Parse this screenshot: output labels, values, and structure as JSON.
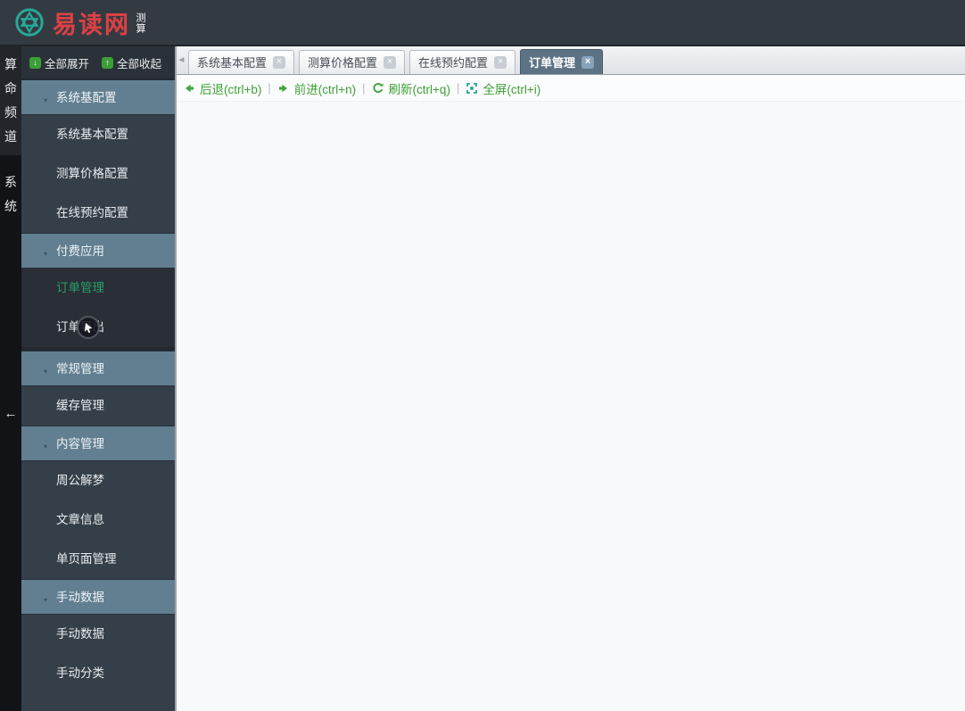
{
  "topbar": {
    "logo_text": "易读网",
    "logo_badge": "测算",
    "logo_icon": "hexagram-circle-icon",
    "colors": {
      "logo_red": "#dd4144",
      "logo_teal": "#27a898",
      "bar_bg": "#343a42"
    }
  },
  "channel_strip": {
    "channels": [
      {
        "label": "算命频道",
        "active": true
      },
      {
        "label": "系统",
        "active": false
      }
    ],
    "collapse_arrow": "←"
  },
  "sidebar": {
    "expand_all": "全部展开",
    "collapse_all": "全部收起",
    "expand_icon": "green-down-arrow-icon",
    "collapse_icon": "green-up-arrow-icon",
    "groups": [
      {
        "label": "系统基配置",
        "dark_submenu": false,
        "items": [
          {
            "label": "系统基本配置",
            "active": false
          },
          {
            "label": "测算价格配置",
            "active": false
          },
          {
            "label": "在线预约配置",
            "active": false
          }
        ]
      },
      {
        "label": "付费应用",
        "dark_submenu": true,
        "items": [
          {
            "label": "订单管理",
            "active": true
          },
          {
            "label": "订单导出",
            "active": false
          }
        ]
      },
      {
        "label": "常规管理",
        "dark_submenu": false,
        "items": [
          {
            "label": "缓存管理",
            "active": false
          }
        ]
      },
      {
        "label": "内容管理",
        "dark_submenu": false,
        "items": [
          {
            "label": "周公解梦",
            "active": false
          },
          {
            "label": "文章信息",
            "active": false
          },
          {
            "label": "单页面管理",
            "active": false
          }
        ]
      },
      {
        "label": "手动数据",
        "dark_submenu": false,
        "items": [
          {
            "label": "手动数据",
            "active": false
          },
          {
            "label": "手动分类",
            "active": false
          }
        ]
      }
    ],
    "colors": {
      "group_header": "#617f90",
      "item_bg": "#353f4a",
      "dark_submenu_bg": "#2a2e37",
      "active_item_green": "#27a065"
    }
  },
  "tabstrip": {
    "scroll_left_arrow": "◄",
    "tabs": [
      {
        "label": "系统基本配置",
        "active": false,
        "close": "×"
      },
      {
        "label": "测算价格配置",
        "active": false,
        "close": "×"
      },
      {
        "label": "在线预约配置",
        "active": false,
        "close": "×"
      },
      {
        "label": "订单管理",
        "active": true,
        "close": "×"
      }
    ],
    "colors": {
      "active_tab_bg": "#5d7284"
    }
  },
  "cmdbar": {
    "actions": [
      {
        "label": "后退(ctrl+b)",
        "icon": "back-arrow-icon"
      },
      {
        "label": "前进(ctrl+n)",
        "icon": "forward-arrow-icon"
      },
      {
        "label": "刷新(ctrl+q)",
        "icon": "refresh-icon"
      },
      {
        "label": "全屏(ctrl+i)",
        "icon": "fullscreen-icon"
      }
    ],
    "separator": "|",
    "colors": {
      "text_green": "#3fa136",
      "icon_green": "#45a53f",
      "icon_teal": "#2da29b"
    }
  },
  "cursor": {
    "icon": "recorded-mouse-cursor-icon"
  }
}
